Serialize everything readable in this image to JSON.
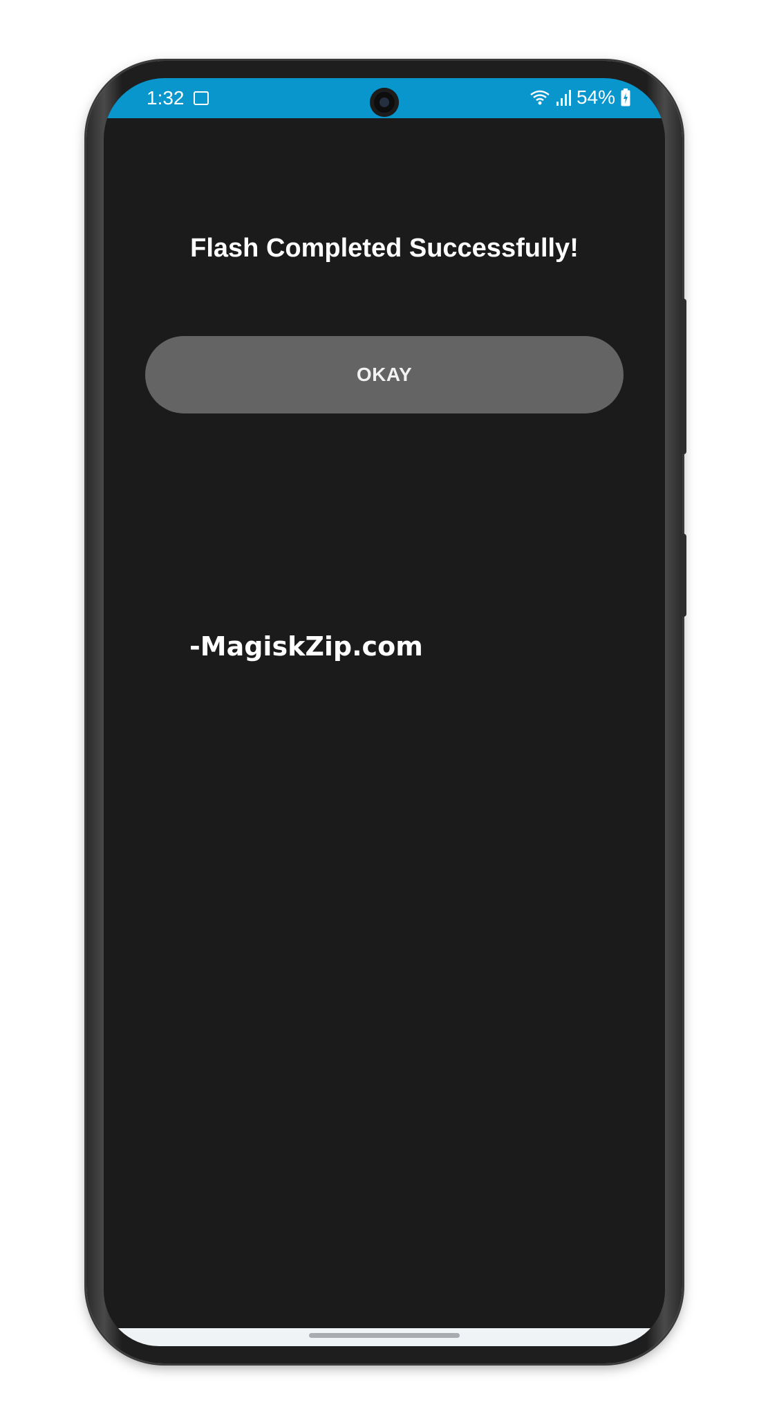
{
  "status_bar": {
    "time": "1:32",
    "battery": "54%",
    "icons": [
      "image-icon",
      "wifi-icon",
      "signal-icon",
      "battery-charging-icon"
    ]
  },
  "dialog": {
    "title": "Flash Completed Successfully!",
    "okay_label": "OKAY"
  },
  "watermark": "-MagiskZip.com",
  "colors": {
    "status_bar": "#0896cd",
    "screen_background": "#1b1b1b",
    "button": "#646464",
    "nav_bar": "#f0f3f6"
  }
}
